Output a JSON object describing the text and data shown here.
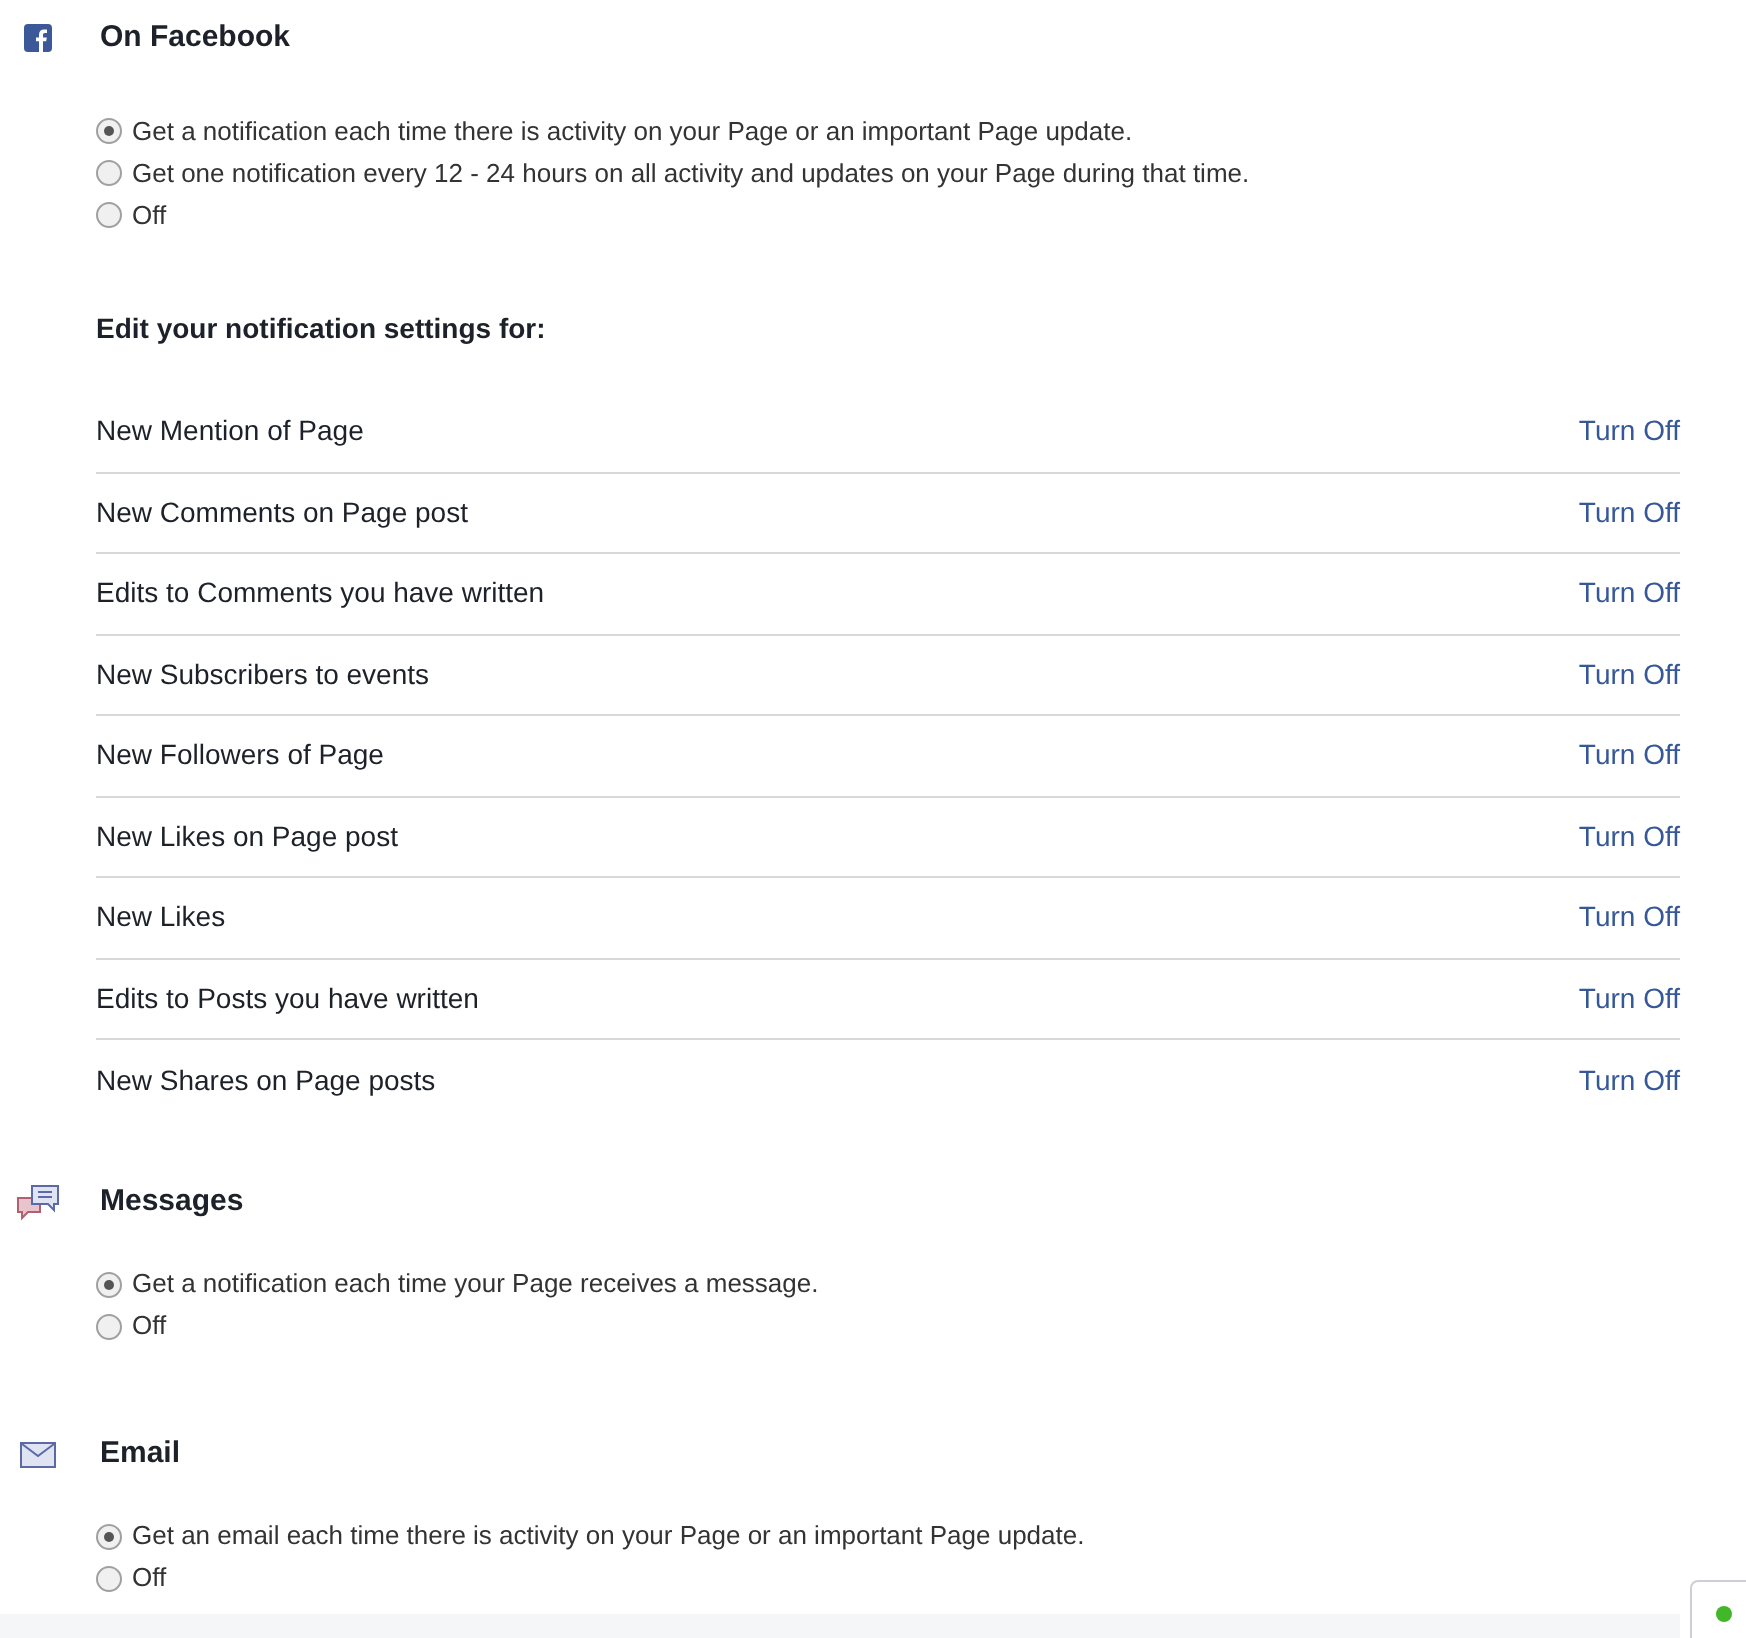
{
  "sections": [
    {
      "kind": "facebook",
      "title": "On Facebook",
      "options": [
        {
          "label": "Get a notification each time there is activity on your Page or an important Page update.",
          "selected": true
        },
        {
          "label": "Get one notification every 12 - 24 hours on all activity and updates on your Page during that time.",
          "selected": false
        },
        {
          "label": "Off",
          "selected": false
        }
      ],
      "settings": {
        "heading": "Edit your notification settings for:",
        "rows": [
          {
            "label": "New Mention of Page",
            "action": "Turn Off"
          },
          {
            "label": "New Comments on Page post",
            "action": "Turn Off"
          },
          {
            "label": "Edits to Comments you have written",
            "action": "Turn Off"
          },
          {
            "label": "New Subscribers to events",
            "action": "Turn Off"
          },
          {
            "label": "New Followers of Page",
            "action": "Turn Off"
          },
          {
            "label": "New Likes on Page post",
            "action": "Turn Off"
          },
          {
            "label": "New Likes",
            "action": "Turn Off"
          },
          {
            "label": "Edits to Posts you have written",
            "action": "Turn Off"
          },
          {
            "label": "New Shares on Page posts",
            "action": "Turn Off"
          }
        ]
      }
    },
    {
      "kind": "messages",
      "title": "Messages",
      "options": [
        {
          "label": "Get a notification each time your Page receives a message.",
          "selected": true
        },
        {
          "label": "Off",
          "selected": false
        }
      ]
    },
    {
      "kind": "email",
      "title": "Email",
      "options": [
        {
          "label": "Get an email each time there is activity on your Page or an important Page update.",
          "selected": true
        },
        {
          "label": "Off",
          "selected": false
        }
      ]
    }
  ]
}
